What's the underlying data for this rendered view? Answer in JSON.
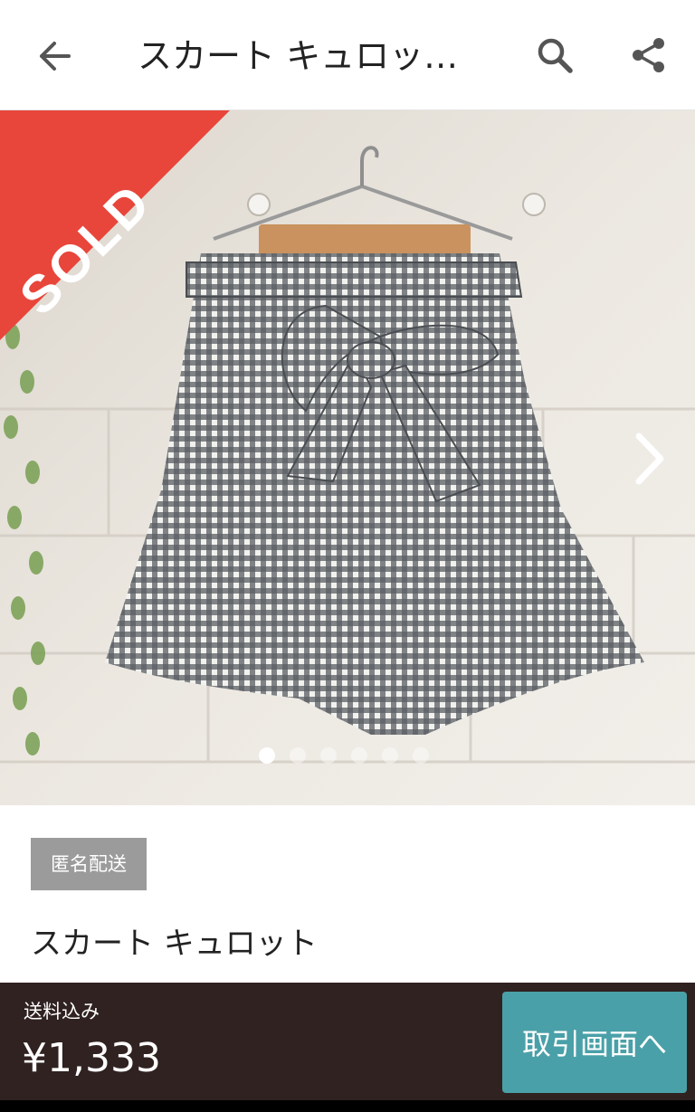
{
  "header": {
    "title": "スカート キュロッ…",
    "back_icon": "arrow-left-icon",
    "search_icon": "search-icon",
    "share_icon": "share-icon"
  },
  "photo": {
    "sold_label": "SOLD",
    "sold_color": "#e8463b",
    "next_icon": "chevron-right-icon",
    "page_count": 6,
    "active_page": 1
  },
  "product": {
    "shipping_badge": "匿名配送",
    "name": "スカート キュロット"
  },
  "footer": {
    "shipping_note": "送料込み",
    "price": "¥1,333",
    "transaction_button": "取引画面へ",
    "bar_color": "#2f2220",
    "button_color": "#4aa0a8"
  }
}
